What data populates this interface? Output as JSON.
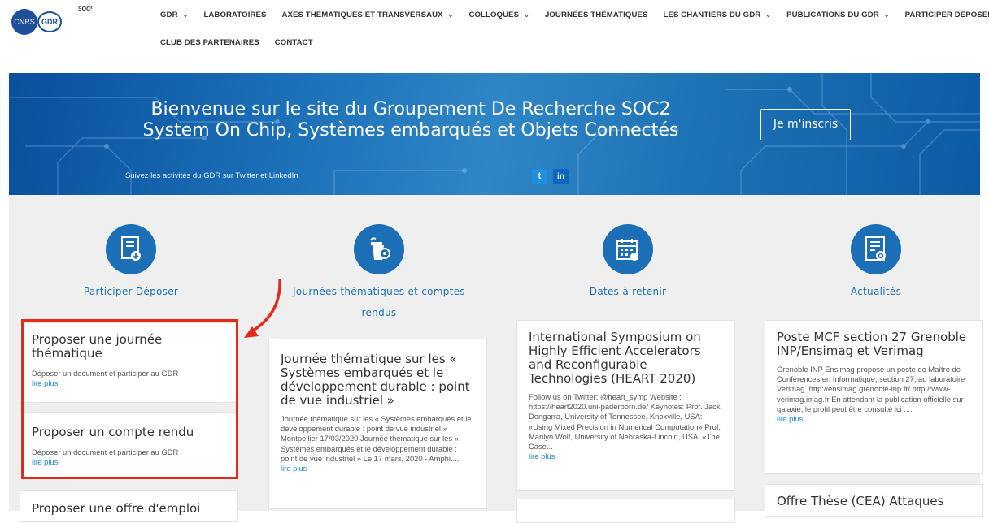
{
  "header": {
    "logo": {
      "cnrs": "CNRS",
      "gdr": "GDR",
      "soc": "SOC²"
    },
    "nav_row1": [
      {
        "label": "GDR",
        "dropdown": true
      },
      {
        "label": "LABORATOIRES",
        "dropdown": false
      },
      {
        "label": "AXES THÉMATIQUES ET TRANSVERSAUX",
        "dropdown": true
      },
      {
        "label": "COLLOQUES",
        "dropdown": true
      },
      {
        "label": "JOURNÉES THÉMATIQUES",
        "dropdown": false
      },
      {
        "label": "LES CHANTIERS DU GDR",
        "dropdown": true
      },
      {
        "label": "PUBLICATIONS DU GDR",
        "dropdown": true
      },
      {
        "label": "PARTICIPER DÉPOSER",
        "dropdown": false
      }
    ],
    "nav_row2": [
      {
        "label": "CLUB DES PARTENAIRES",
        "dropdown": false
      },
      {
        "label": "CONTACT",
        "dropdown": false
      }
    ]
  },
  "hero": {
    "title_line1": "Bienvenue sur le site du Groupement De Recherche SOC2",
    "title_line2": "System On Chip, Systèmes embarqués et Objets Connectés",
    "follow_text": "Suivez les activités du GDR sur Twitter et LinkedIn",
    "twitter": "t",
    "linkedin": "in",
    "signup_button": "Je m'inscris"
  },
  "columns": [
    {
      "title": "Participer Déposer",
      "icon": "document-upload-icon",
      "cards": [
        {
          "title": "Proposer une journée thématique",
          "desc": "Déposer un document et participer au GDR",
          "link": "lire plus"
        },
        {
          "title": "Proposer un compte rendu",
          "desc": "Déposer un document et participer au GDR",
          "link": "lire plus"
        },
        {
          "title": "Proposer une offre d'emploi",
          "desc": "",
          "link": ""
        }
      ]
    },
    {
      "title": "Journées thématiques et comptes rendus",
      "icon": "podium-location-icon",
      "cards": [
        {
          "title": "Journée thématique sur les « Systèmes embarqués et le développement durable : point de vue industriel »",
          "desc": "Journée thématique sur les « Systèmes embarqués et le développement durable : point de vue industriel » Montpellier 17/03/2020 Journée thématique sur les  « Systèmes embarqués et le développement durable : point de vue industriel » Le 17 mars, 2020 - Amphi....",
          "link": "lire plus"
        }
      ]
    },
    {
      "title": "Dates à retenir",
      "icon": "calendar-icon",
      "cards": [
        {
          "title": "International Symposium on Highly Efficient Accelerators and Reconfigurable Technologies (HEART 2020)",
          "desc": "Follow us on Twitter: @heart_symp Website : https://heart2020.uni-paderborn.de/ Keynotes: Prof. Jack Dongarra, University of Tennessee, Knoxville, USA: «Using Mixed Precision in Numerical Computation» Prof. Marilyn Wolf, University of Nebraska-Lincoln, USA: «The Case...",
          "link": "lire plus"
        }
      ]
    },
    {
      "title": "Actualités",
      "icon": "news-document-icon",
      "cards": [
        {
          "title": "Poste MCF section 27 Grenoble INP/Ensimag et Verimag",
          "desc": "Grenoble INP Ensimag propose un poste de Maître de Conférences en Informatique, section 27, au laboratoire Verimag. http://ensimag.grenoble-inp.fr/ http://www-verimag.imag.fr En attendant la publication officielle sur galaxie, le profil peut être consulté ici :...",
          "link": "lire plus"
        },
        {
          "title": "Offre Thèse (CEA) Attaques",
          "desc": "",
          "link": ""
        }
      ]
    }
  ],
  "colors": {
    "accent": "#1c6fb6",
    "link": "#1f8ed6",
    "highlight": "#e52a1b"
  }
}
